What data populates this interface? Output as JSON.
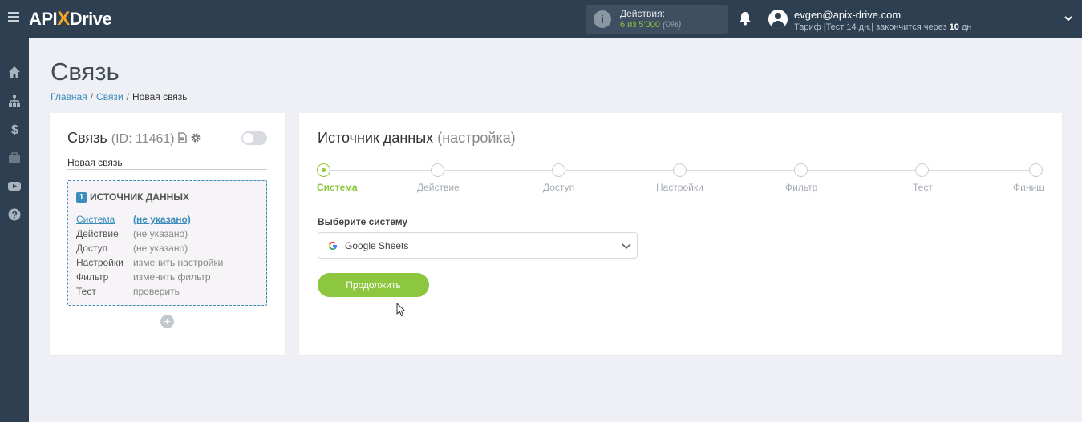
{
  "app": {
    "logo_api": "API",
    "logo_x": "X",
    "logo_drive": "Drive"
  },
  "topbar": {
    "actions_label": "Действия:",
    "actions_value": "6 из 5'000",
    "actions_percent": "(0%)",
    "user_email": "evgen@apix-drive.com",
    "plan_prefix": "Тариф |Тест 14 дн.| закончится через ",
    "plan_days": "10",
    "plan_suffix": " дн"
  },
  "sidebar": {
    "items": [
      {
        "icon": "home-icon"
      },
      {
        "icon": "sitemap-icon"
      },
      {
        "icon": "dollar-icon"
      },
      {
        "icon": "briefcase-icon"
      },
      {
        "icon": "youtube-icon"
      },
      {
        "icon": "help-icon"
      }
    ]
  },
  "page": {
    "title": "Связь",
    "breadcrumb": [
      "Главная",
      "Связи",
      "Новая связь"
    ]
  },
  "connection": {
    "title": "Связь",
    "id_text": "(ID: 11461)",
    "name": "Новая связь",
    "enabled": false,
    "source_badge": "1",
    "source_title": "ИСТОЧНИК ДАННЫХ",
    "rows": [
      {
        "key": "Система",
        "value": "(не указано)"
      },
      {
        "key": "Действие",
        "value": "(не указано)"
      },
      {
        "key": "Доступ",
        "value": "(не указано)"
      },
      {
        "key": "Настройки",
        "value": "изменить настройки"
      },
      {
        "key": "Фильтр",
        "value": "изменить фильтр"
      },
      {
        "key": "Тест",
        "value": "проверить"
      }
    ],
    "add_label": "+"
  },
  "source": {
    "title": "Источник данных",
    "title_sub": "(настройка)",
    "steps": [
      "Система",
      "Действие",
      "Доступ",
      "Настройки",
      "Фильтр",
      "Тест",
      "Финиш"
    ],
    "active_step": 0,
    "field_label": "Выберите систему",
    "selected_system": "Google Sheets",
    "continue_label": "Продолжить"
  },
  "colors": {
    "accent_green": "#8dc63f",
    "link_blue": "#3d8dbc",
    "dark_nav": "#2d3f50"
  }
}
